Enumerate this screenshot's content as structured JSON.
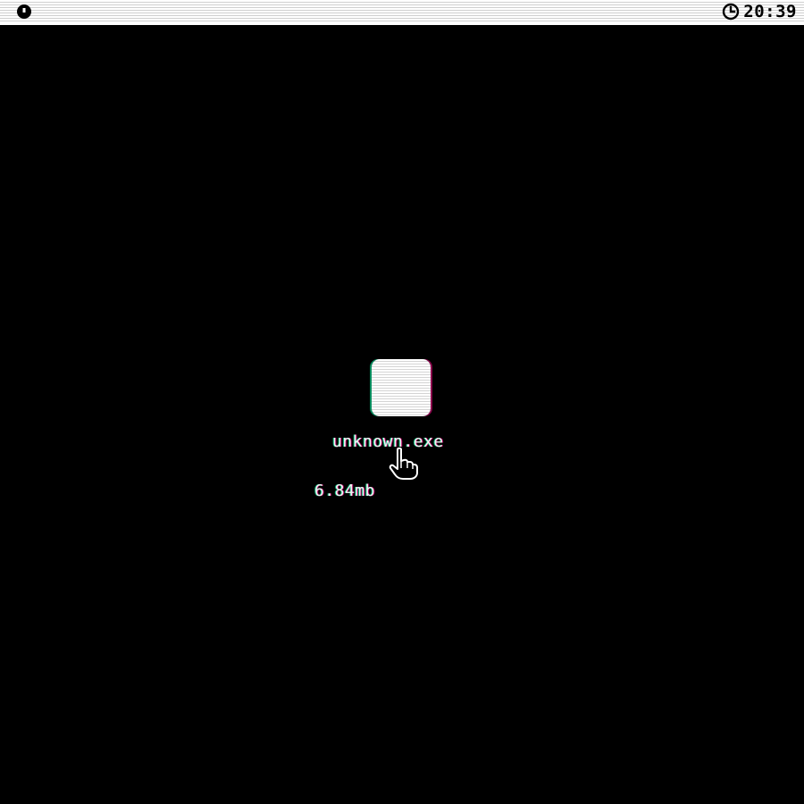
{
  "menubar": {
    "logo_icon": "system-menu-icon",
    "clock_icon": "clock-icon",
    "time": "20:39"
  },
  "desktop": {
    "file": {
      "icon": "file-icon",
      "name": "unknown.exe",
      "size": "6.84mb"
    },
    "cursor": "pointing-hand-cursor"
  },
  "colors": {
    "background": "#000000",
    "foreground": "#ffffff",
    "fringe_cyan": "#00ffaa",
    "fringe_magenta": "#ff008c"
  }
}
